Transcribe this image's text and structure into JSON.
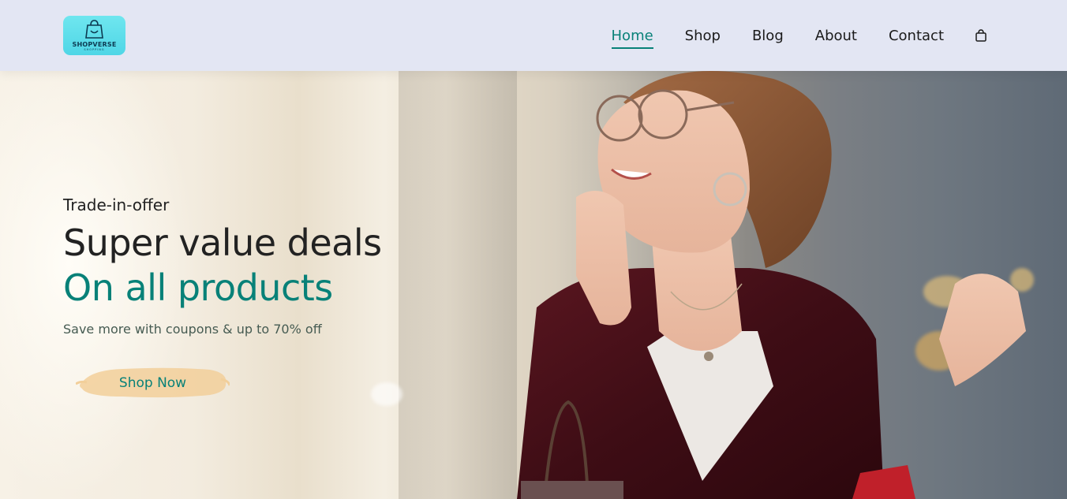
{
  "brand": {
    "name": "SHOPVERSE",
    "tagline": "SHOPPING",
    "accent": "#088178",
    "logo_bg": "#5adbe8",
    "header_bg": "#e3e6f3"
  },
  "nav": {
    "items": [
      {
        "label": "Home",
        "active": true
      },
      {
        "label": "Shop",
        "active": false
      },
      {
        "label": "Blog",
        "active": false
      },
      {
        "label": "About",
        "active": false
      },
      {
        "label": "Contact",
        "active": false
      }
    ],
    "cart_icon": "shopping-bag-icon"
  },
  "hero": {
    "kicker": "Trade-in-offer",
    "headline": "Super value deals",
    "headline_accent": "On all products",
    "subtitle": "Save more with coupons & up to 70% off",
    "cta_label": "Shop Now",
    "cta_bg": "#f2cf9a"
  }
}
